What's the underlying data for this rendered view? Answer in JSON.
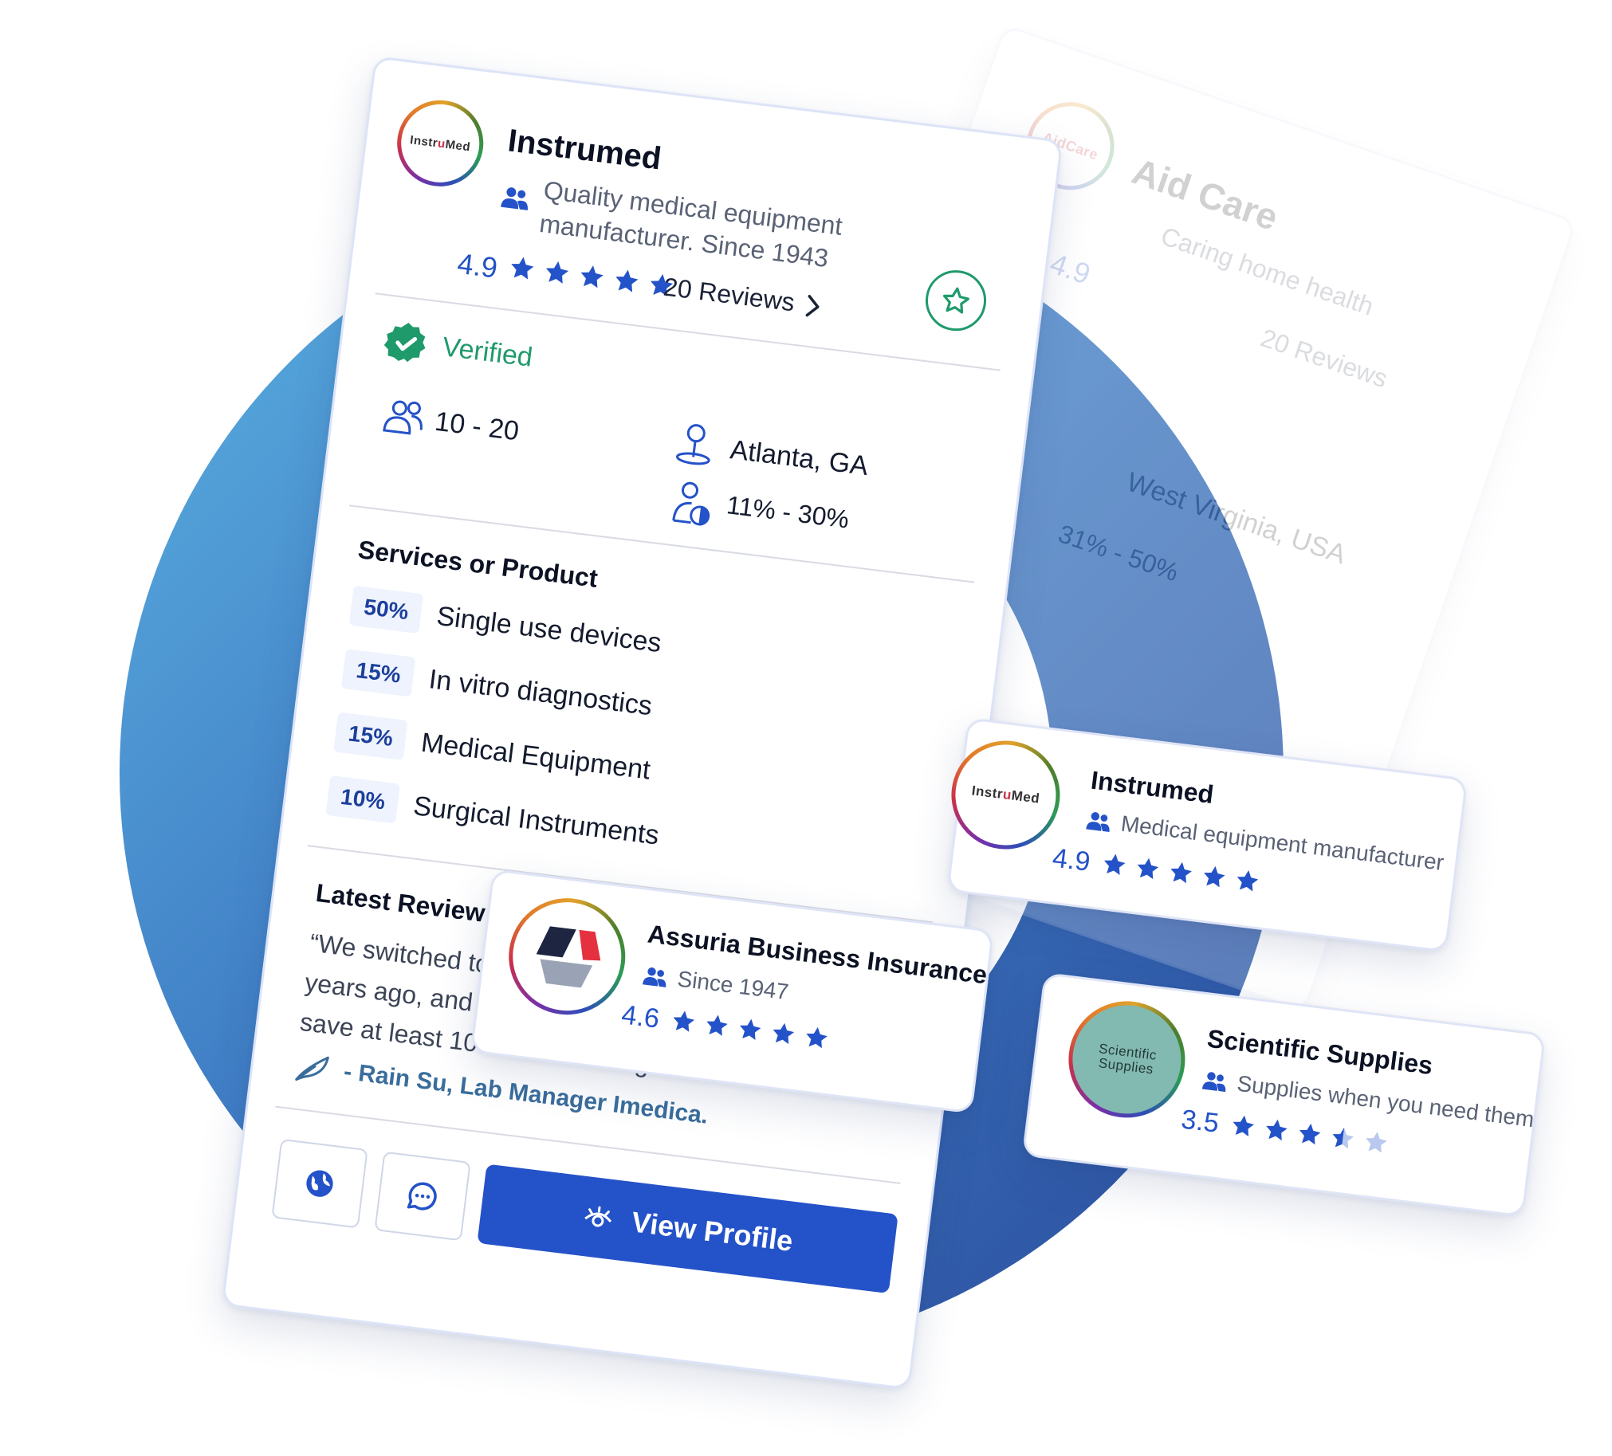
{
  "colors": {
    "donut_light": "#5aaee0",
    "donut_dark": "#2d52a8",
    "brand_blue": "#2452c8",
    "verified_green": "#1f9a6b"
  },
  "back_card": {
    "logo_text": "AidCare",
    "name": "Aid Care",
    "tagline": "Caring home health",
    "rating": "4.9",
    "reviews": "20 Reviews",
    "location": "West Virginia, USA",
    "percent_range": "31% - 50%"
  },
  "main_card": {
    "logo_text_a": "Instr",
    "logo_text_b": "u",
    "logo_text_c": "Med",
    "name": "Instrumed",
    "tagline_line1": "Quality medical equipment",
    "tagline_line2": "manufacturer. Since 1943",
    "rating": "4.9",
    "rating_value": 5,
    "reviews": "20 Reviews",
    "verified": "Verified",
    "employees": "10 - 20",
    "location": "Atlanta, GA",
    "percent_range": "11% - 30%",
    "services_title": "Services or Product",
    "services": [
      {
        "pct": "50%",
        "label": "Single use devices"
      },
      {
        "pct": "15%",
        "label": "In vitro diagnostics"
      },
      {
        "pct": "15%",
        "label": "Medical Equipment"
      },
      {
        "pct": "10%",
        "label": "Surgical Instruments"
      }
    ],
    "review_title": "Latest Review",
    "review_quote": "“We switched to S",
    "review_line2": "years ago, and the increased quality has allowed to",
    "review_line3": "save at least 10% in restocking costs each month.”",
    "reviewer": "- Rain Su, Lab Manager Imedica.",
    "view_profile": "View Profile"
  },
  "mini_instrumed": {
    "logo_text_a": "Instr",
    "logo_text_b": "u",
    "logo_text_c": "Med",
    "name": "Instrumed",
    "tagline": "Medical equipment manufacturer",
    "rating": "4.9",
    "rating_value": 5
  },
  "mini_assuria": {
    "name": "Assuria Business Insurance",
    "tagline": "Since 1947",
    "rating": "4.6",
    "rating_value": 5
  },
  "mini_scientific": {
    "logo_line1": "Scientific",
    "logo_line2": "Supplies",
    "name": "Scientific Supplies",
    "tagline": "Supplies when you need them",
    "rating": "3.5",
    "rating_value": 3.5
  }
}
